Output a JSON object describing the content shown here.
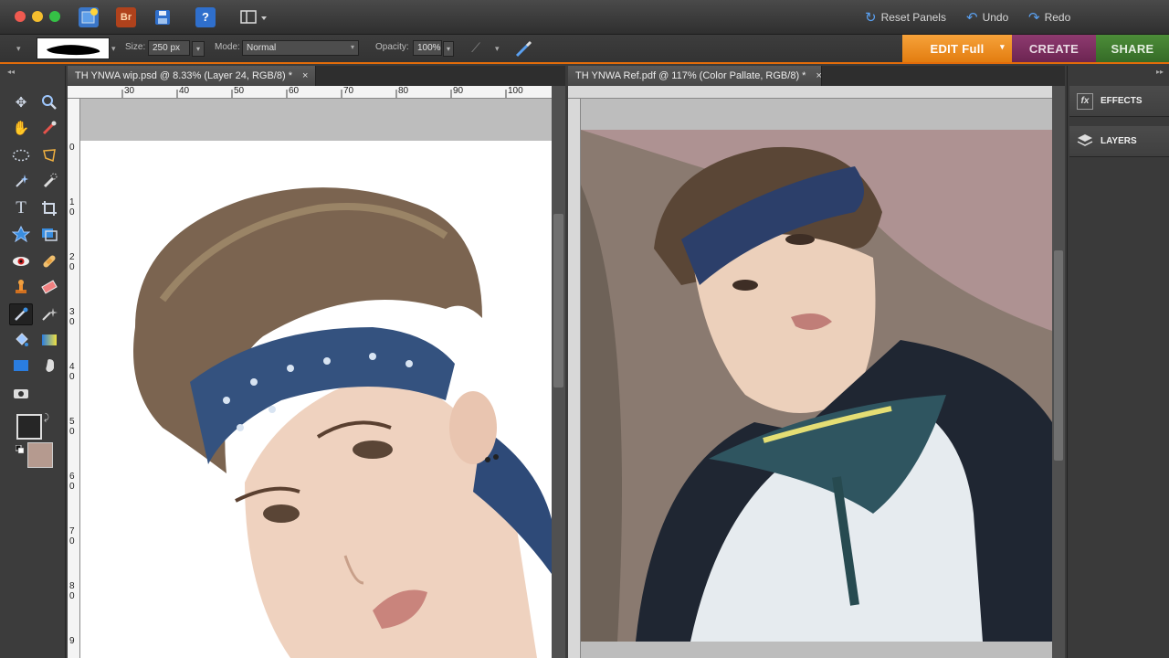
{
  "topbar": {
    "reset_panels": "Reset Panels",
    "undo": "Undo",
    "redo": "Redo",
    "icons": [
      "new-file-icon",
      "bridge-icon",
      "save-icon",
      "help-icon",
      "workspace-layout-icon"
    ],
    "bridge_label": "Br",
    "help_label": "?"
  },
  "options": {
    "size_label": "Size:",
    "size_value": "250 px",
    "mode_label": "Mode:",
    "mode_value": "Normal",
    "opacity_label": "Opacity:",
    "opacity_value": "100%"
  },
  "mode_tabs": {
    "edit": "EDIT Full",
    "create": "CREATE",
    "share": "SHARE"
  },
  "colors": {
    "accent_orange": "#e36c0a",
    "edit_tab": "#f08c1a",
    "create_tab": "#7d2a5f",
    "share_tab": "#3f7a2e",
    "foreground_swatch": "#262626",
    "background_swatch": "#b59a8f"
  },
  "documents": [
    {
      "title": "TH YNWA wip.psd @ 8.33% (Layer 24, RGB/8) *",
      "close": "×",
      "ruler_h": [
        "30",
        "40",
        "50",
        "60",
        "70",
        "80",
        "90",
        "100"
      ],
      "ruler_v": [
        "0",
        "1 0",
        "2 0",
        "3 0",
        "4 0",
        "5 0",
        "6 0",
        "7 0",
        "8 0",
        "9"
      ]
    },
    {
      "title": "TH YNWA Ref.pdf @ 117% (Color Pallate, RGB/8) *",
      "close": "×"
    }
  ],
  "panels": {
    "effects": "EFFECTS",
    "layers": "LAYERS"
  }
}
